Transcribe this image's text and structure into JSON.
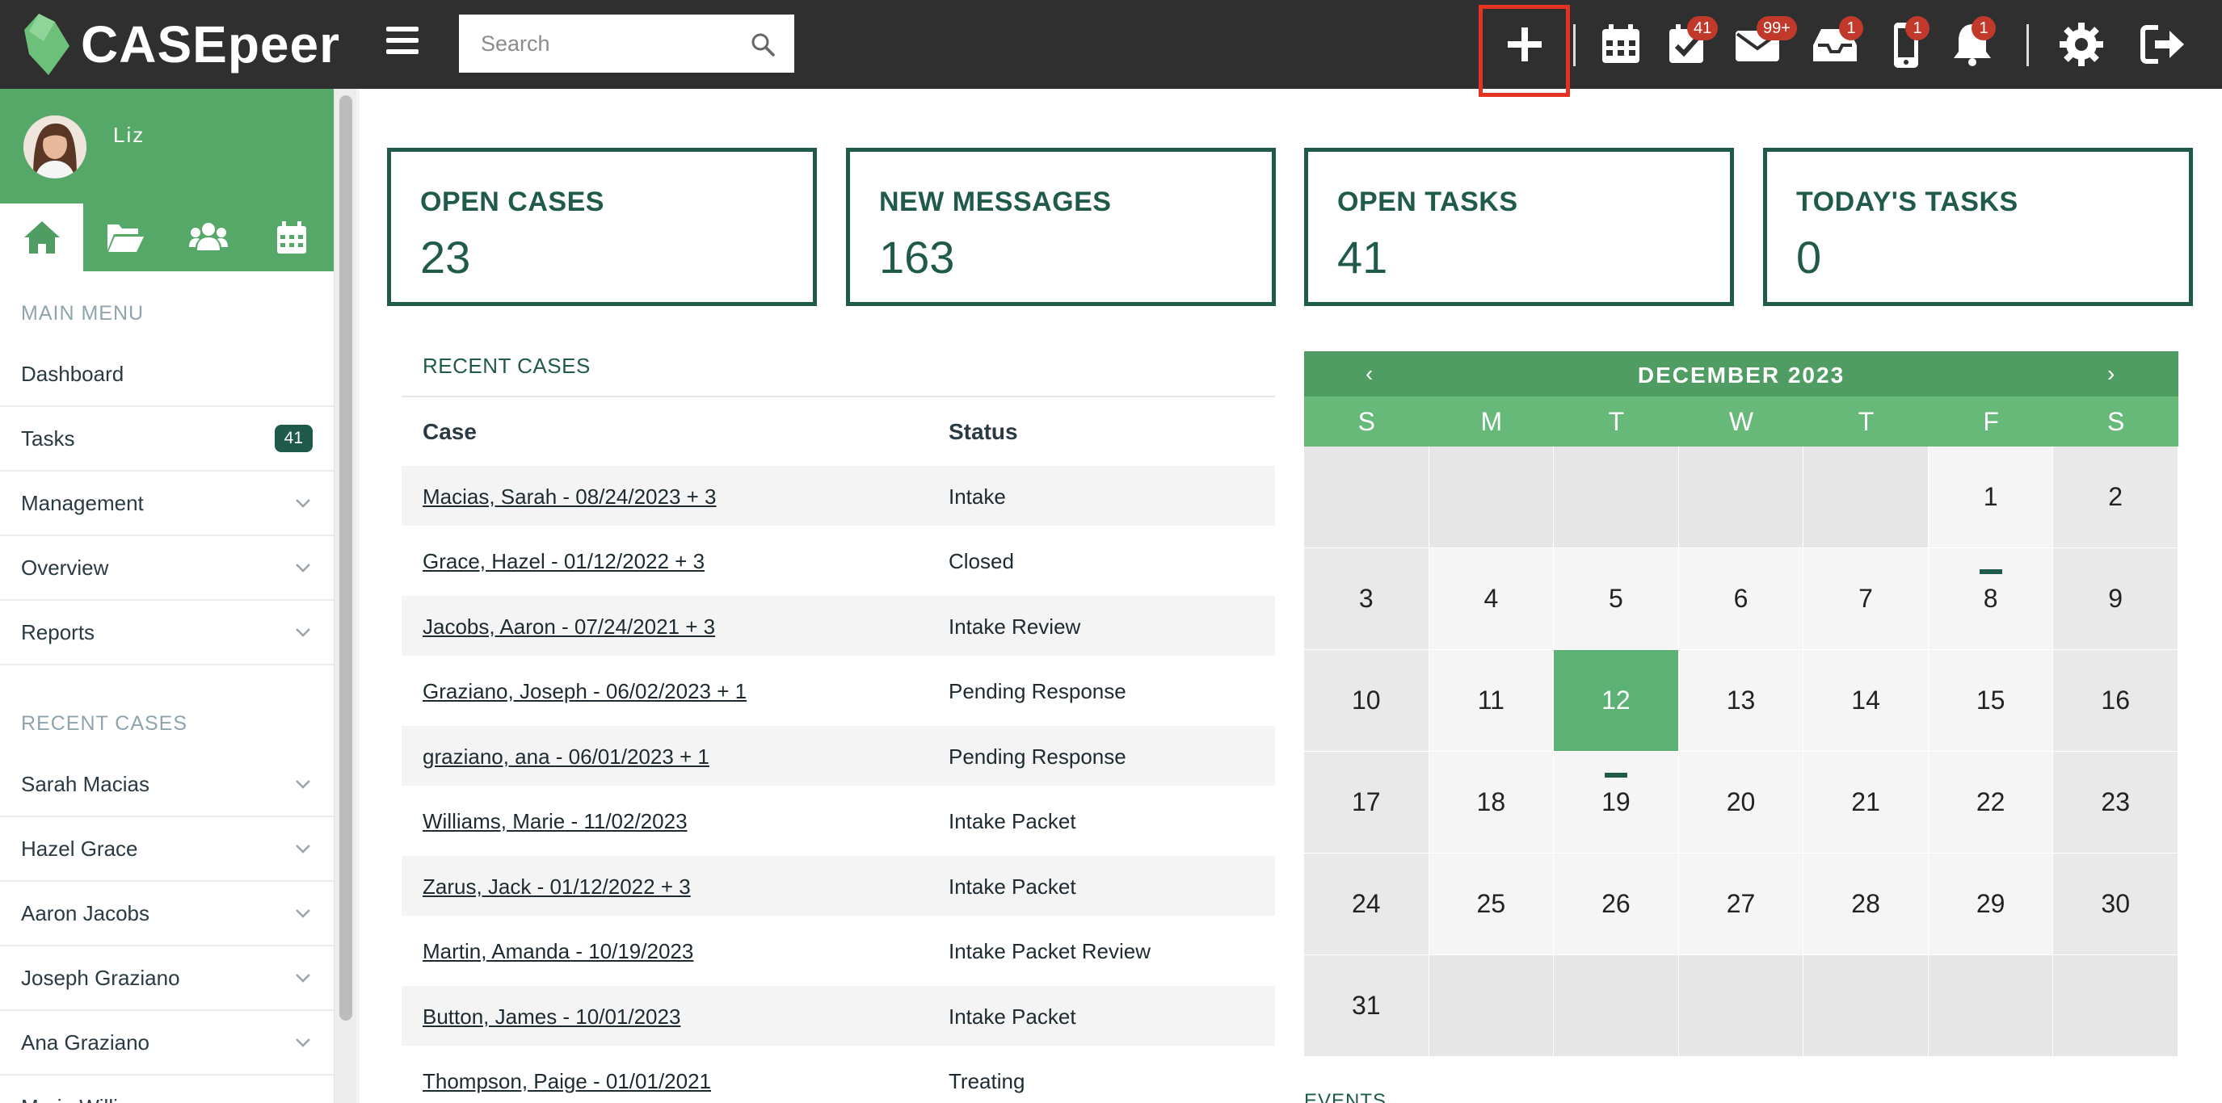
{
  "app": {
    "brand": "CASEpeer"
  },
  "header": {
    "search_placeholder": "Search",
    "icons": [
      {
        "name": "add-icon",
        "badge": ""
      },
      {
        "name": "calendar-icon",
        "badge": ""
      },
      {
        "name": "tasks-icon",
        "badge": "41"
      },
      {
        "name": "mail-icon",
        "badge": "99+"
      },
      {
        "name": "inbox-icon",
        "badge": "1"
      },
      {
        "name": "phone-icon",
        "badge": "1"
      },
      {
        "name": "bell-icon",
        "badge": "1"
      },
      {
        "name": "gear-icon",
        "badge": ""
      },
      {
        "name": "logout-icon",
        "badge": ""
      }
    ],
    "highlight_color": "#e53322"
  },
  "sidebar": {
    "user_name": "Liz",
    "tabs": [
      {
        "name": "home-icon"
      },
      {
        "name": "folder-open-icon"
      },
      {
        "name": "users-icon"
      },
      {
        "name": "calendar-icon"
      }
    ],
    "main_menu_heading": "MAIN MENU",
    "main_menu": [
      {
        "label": "Dashboard",
        "count": ""
      },
      {
        "label": "Tasks",
        "count": "41"
      },
      {
        "label": "Management",
        "count": ""
      },
      {
        "label": "Overview",
        "count": ""
      },
      {
        "label": "Reports",
        "count": ""
      }
    ],
    "recent_heading": "RECENT CASES",
    "recent": [
      {
        "label": "Sarah Macias"
      },
      {
        "label": "Hazel Grace"
      },
      {
        "label": "Aaron Jacobs"
      },
      {
        "label": "Joseph Graziano"
      },
      {
        "label": "Ana Graziano"
      },
      {
        "label": "Marie Williams"
      }
    ]
  },
  "stats": [
    {
      "title": "OPEN CASES",
      "value": "23"
    },
    {
      "title": "NEW MESSAGES",
      "value": "163"
    },
    {
      "title": "OPEN TASKS",
      "value": "41"
    },
    {
      "title": "TODAY'S TASKS",
      "value": "0"
    }
  ],
  "recent_cases": {
    "title": "RECENT CASES",
    "columns": [
      "Case",
      "Status"
    ],
    "rows": [
      {
        "case": "Macias, Sarah - 08/24/2023 + 3",
        "status": "Intake"
      },
      {
        "case": "Grace, Hazel - 01/12/2022 + 3",
        "status": "Closed"
      },
      {
        "case": "Jacobs, Aaron - 07/24/2021 + 3",
        "status": "Intake Review"
      },
      {
        "case": "Graziano, Joseph - 06/02/2023 + 1",
        "status": "Pending Response"
      },
      {
        "case": "graziano, ana - 06/01/2023 + 1",
        "status": "Pending Response"
      },
      {
        "case": "Williams, Marie - 11/02/2023",
        "status": "Intake Packet"
      },
      {
        "case": "Zarus, Jack - 01/12/2022 + 3",
        "status": "Intake Packet"
      },
      {
        "case": "Martin, Amanda - 10/19/2023",
        "status": "Intake Packet Review"
      },
      {
        "case": "Button, James - 10/01/2023",
        "status": "Intake Packet"
      },
      {
        "case": "Thompson, Paige - 01/01/2021",
        "status": "Treating"
      }
    ]
  },
  "calendar": {
    "month": "DECEMBER 2023",
    "prev": "‹",
    "next": "›",
    "weekdays": [
      "S",
      "M",
      "T",
      "W",
      "T",
      "F",
      "S"
    ],
    "first_weekday": 5,
    "days_in_month": 31,
    "today": 12,
    "event_days": [
      8,
      19
    ],
    "today_color": "#5cb274"
  },
  "events_label": "EVENTS"
}
